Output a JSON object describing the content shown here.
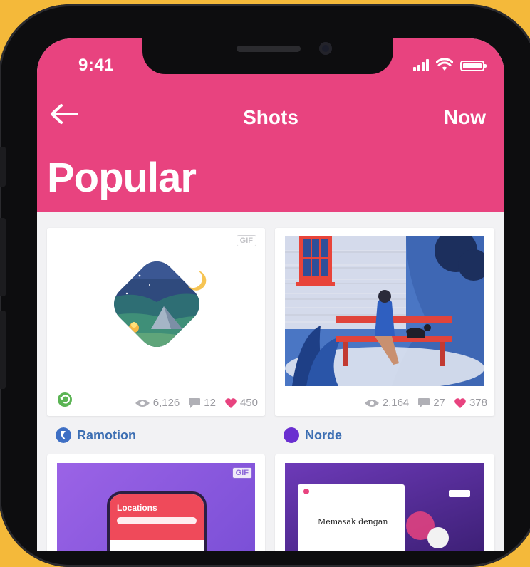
{
  "status_bar": {
    "time": "9:41"
  },
  "nav": {
    "title": "Shots",
    "right_label": "Now"
  },
  "page": {
    "title": "Popular"
  },
  "shots": [
    {
      "badge": "GIF",
      "views": "6,126",
      "comments": "12",
      "likes": "450",
      "author": "Ramotion"
    },
    {
      "badge": "",
      "views": "2,164",
      "comments": "27",
      "likes": "378",
      "author": "Norde"
    },
    {
      "badge": "GIF",
      "preview_title": "Locations"
    },
    {
      "preview_title": "Memasak dengan"
    }
  ],
  "colors": {
    "header": "#e8437f",
    "background": "#f4b93a",
    "author": "#3d6fb3",
    "like": "#e8437f"
  }
}
